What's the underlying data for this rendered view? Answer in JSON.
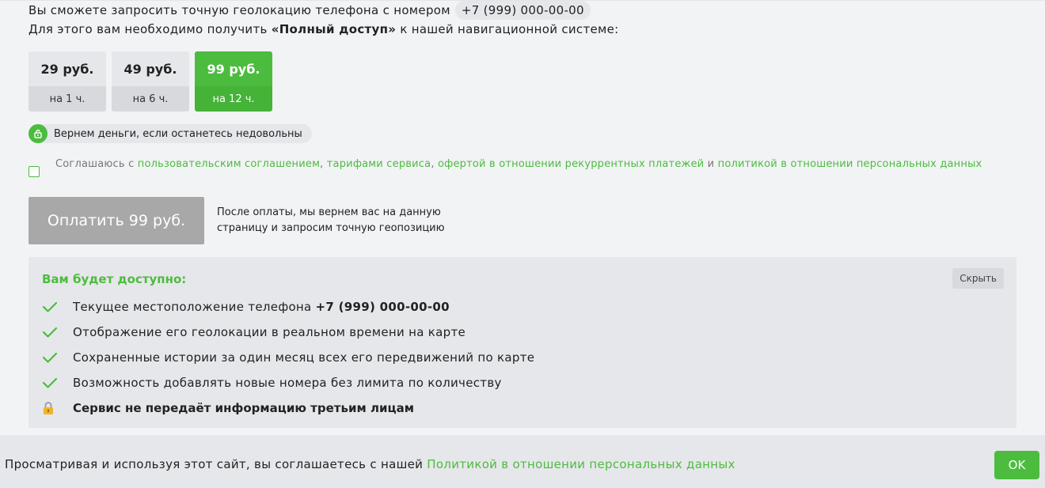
{
  "intro": {
    "line1": "Вы сможете запросить точную геолокацию телефона с номером",
    "phone": "+7 (999) 000-00-00",
    "line2_before": "Для этого вам необходимо получить",
    "line2_bold": "«Полный доступ»",
    "line2_after": "к нашей навигационной системе:"
  },
  "plans": [
    {
      "price": "29 руб.",
      "duration": "на 1 ч.",
      "selected": false
    },
    {
      "price": "49 руб.",
      "duration": "на 6 ч.",
      "selected": false
    },
    {
      "price": "99 руб.",
      "duration": "на 12 ч.",
      "selected": true
    }
  ],
  "refund": {
    "text": "Вернем деньги, если останетесь недовольны",
    "icon": "shield-refund-icon"
  },
  "agreement": {
    "prefix": "Соглашаюсь с",
    "link1": "пользовательским соглашением",
    "sep1": ",",
    "link2": "тарифами сервиса",
    "sep2": ",",
    "link3": "офертой в отношении рекуррентных платежей",
    "and": "и",
    "link4": "политикой в отношении персональных данных",
    "checked": false
  },
  "payment": {
    "button_label": "Оплатить 99 руб.",
    "note": "После оплаты, мы вернем вас на данную страницу и запросим точную геопозицию"
  },
  "features": {
    "title": "Вам будет доступно:",
    "hide_label": "Скрыть",
    "items": [
      {
        "icon": "check-icon",
        "text": "Текущее местоположение телефона",
        "bold": "+7 (999) 000-00-00"
      },
      {
        "icon": "check-icon",
        "text": "Отображение его геолокации в реальном времени на карте"
      },
      {
        "icon": "check-icon",
        "text": "Сохраненные истории за один месяц всех его передвижений по карте"
      },
      {
        "icon": "check-icon",
        "text": "Возможность добавлять новые номера без лимита по количеству"
      },
      {
        "icon": "lock-icon",
        "text": "Сервис не передаёт информацию третьим лицам"
      }
    ]
  },
  "cookie": {
    "text": "Просматривая и используя этот сайт, вы соглашаетесь с нашей",
    "link": "Политикой в отношении персональных данных",
    "ok_label": "OK"
  },
  "colors": {
    "accent": "#4cbc3f",
    "pay_disabled": "#a8a8a8",
    "panel": "#e6e7ea",
    "background": "#f2f3f5"
  }
}
